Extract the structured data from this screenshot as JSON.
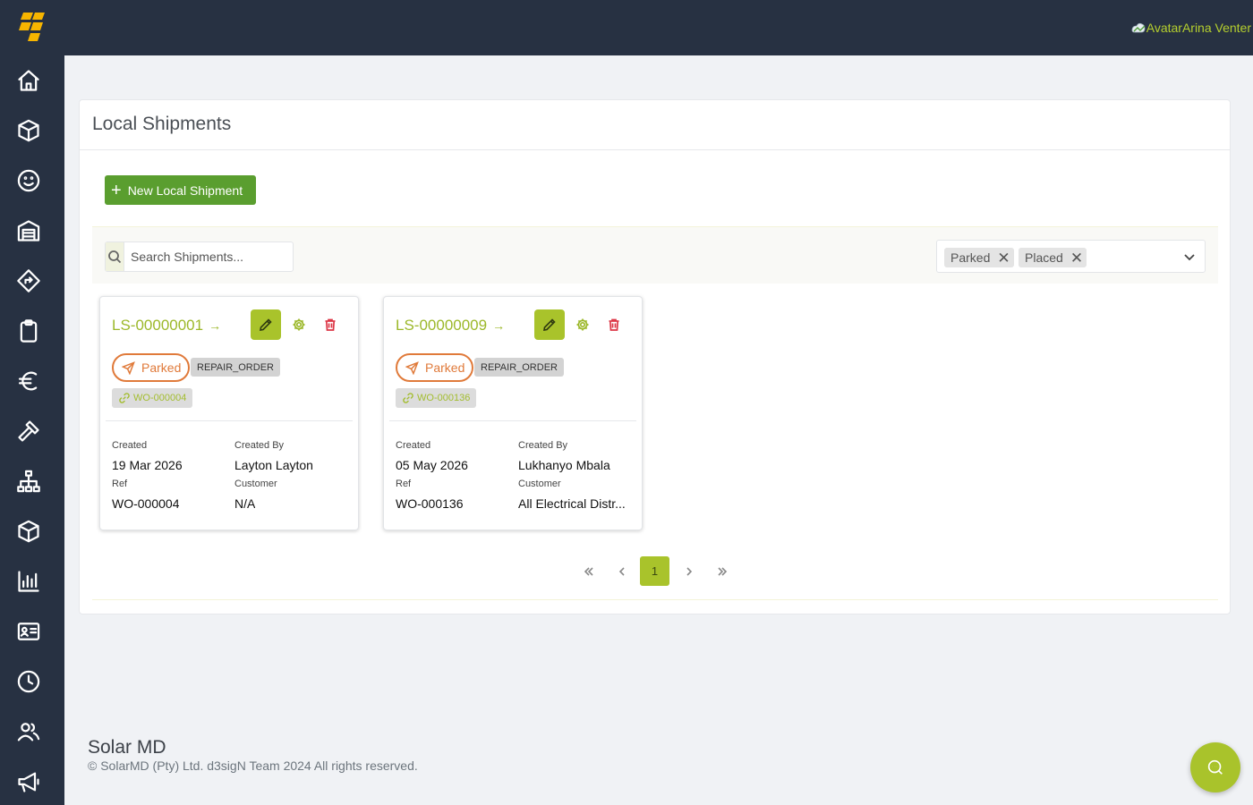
{
  "app": {
    "user_name": "AvatarArina Venter",
    "accent_color": "#a9c32b",
    "sidebar_color": "#273142"
  },
  "sidebar": {
    "items": [
      {
        "icon": "home-icon"
      },
      {
        "icon": "box-icon"
      },
      {
        "icon": "smiley-icon"
      },
      {
        "icon": "warehouse-icon"
      },
      {
        "icon": "directions-icon"
      },
      {
        "icon": "clipboard-icon"
      },
      {
        "icon": "euro-icon"
      },
      {
        "icon": "hammer-icon"
      },
      {
        "icon": "sitemap-icon"
      },
      {
        "icon": "box-icon"
      },
      {
        "icon": "bar-chart-icon"
      },
      {
        "icon": "id-card-icon"
      },
      {
        "icon": "clock-icon"
      },
      {
        "icon": "users-icon"
      },
      {
        "icon": "megaphone-icon"
      }
    ]
  },
  "page": {
    "title": "Local Shipments",
    "new_button_label": "New Local Shipment",
    "search_placeholder": "Search Shipments...",
    "filter_chips": [
      "Parked",
      "Placed"
    ],
    "clear_chip_glyph": "✕"
  },
  "cards": [
    {
      "id": "LS-00000001",
      "status": "Parked",
      "type": "REPAIR_ORDER",
      "work_order": "WO-000004",
      "created_label": "Created",
      "created": "19 Mar 2026",
      "created_by_label": "Created By",
      "created_by": "Layton Layton",
      "ref_label": "Ref",
      "ref": "WO-000004",
      "customer_label": "Customer",
      "customer": "N/A"
    },
    {
      "id": "LS-00000009",
      "status": "Parked",
      "type": "REPAIR_ORDER",
      "work_order": "WO-000136",
      "created_label": "Created",
      "created": "05 May 2026",
      "created_by_label": "Created By",
      "created_by": "Lukhanyo Mbala",
      "ref_label": "Ref",
      "ref": "WO-000136",
      "customer_label": "Customer",
      "customer": "All Electrical Distr..."
    }
  ],
  "pagination": {
    "current_page": "1"
  },
  "footer": {
    "title": "Solar MD",
    "copyright": "© SolarMD (Pty) Ltd. d3sigN Team 2024 All rights reserved."
  }
}
